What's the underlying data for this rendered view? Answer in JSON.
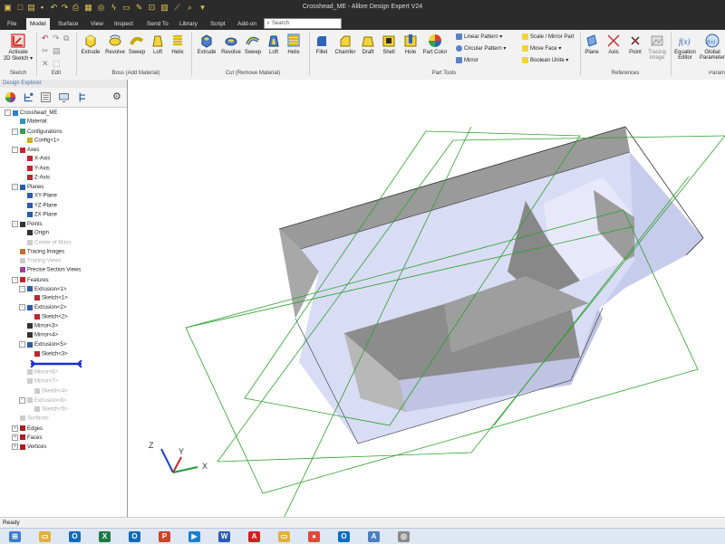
{
  "window": {
    "title": "Crosshead_ME - Alibre Design Expert V24"
  },
  "quick_access": [
    "new-icon",
    "open-icon",
    "save-icon",
    "undo-icon",
    "redo-icon",
    "print-icon",
    "dropdown-icon"
  ],
  "tabs": [
    {
      "label": "File",
      "active": false
    },
    {
      "label": "Model",
      "active": true
    },
    {
      "label": "Surface",
      "active": false
    },
    {
      "label": "View",
      "active": false
    },
    {
      "label": "Inspect",
      "active": false
    },
    {
      "label": "Send To",
      "active": false
    },
    {
      "label": "Library",
      "active": false
    },
    {
      "label": "Script",
      "active": false
    },
    {
      "label": "Add-on",
      "active": false
    }
  ],
  "search": {
    "placeholder": "Search"
  },
  "ribbon": {
    "sketch": {
      "activate_label": "Activate",
      "activate_sub": "2D Sketch ▾",
      "group": "Sketch"
    },
    "edit": {
      "group": "Edit"
    },
    "boss": {
      "group": "Boss (Add Material)",
      "buttons": [
        "Extrude",
        "Revolve",
        "Sweep",
        "Loft",
        "Helix"
      ]
    },
    "cut": {
      "group": "Cut (Remove Material)",
      "buttons": [
        "Extrude",
        "Revolve",
        "Sweep",
        "Loft",
        "Helix"
      ]
    },
    "part_tools": {
      "group": "Part Tools",
      "buttons": [
        "Fillet",
        "Chamfer",
        "Draft",
        "Shell",
        "Hole",
        "Part Color"
      ],
      "small": [
        "Linear Pattern ▾",
        "Circular Pattern ▾",
        "Mirror",
        "Scale / Mirror Part",
        "Move Face ▾",
        "Boolean Unite ▾"
      ]
    },
    "references": {
      "group": "References",
      "buttons": [
        "Plane",
        "Axis",
        "Point",
        "Tracing Image"
      ]
    },
    "params": {
      "buttons": [
        "Equation Editor",
        "Global Parameters"
      ],
      "group": "Param"
    }
  },
  "explorer": {
    "title": "Design Explorer",
    "tree": [
      {
        "label": "Crosshead_ME",
        "indent": 0,
        "exp": "-",
        "icon": "part-icon",
        "dim": false
      },
      {
        "label": "Material:",
        "indent": 1,
        "exp": "",
        "icon": "material-icon",
        "dim": false
      },
      {
        "label": "Configurations",
        "indent": 1,
        "exp": "-",
        "icon": "config-icon",
        "dim": false
      },
      {
        "label": "Config<1>",
        "indent": 2,
        "exp": "",
        "icon": "config-item-icon",
        "dim": false
      },
      {
        "label": "Axes",
        "indent": 1,
        "exp": "-",
        "icon": "axes-icon",
        "dim": false
      },
      {
        "label": "X-Axis",
        "indent": 2,
        "exp": "",
        "icon": "axis-icon",
        "dim": false
      },
      {
        "label": "Y-Axis",
        "indent": 2,
        "exp": "",
        "icon": "axis-icon",
        "dim": false
      },
      {
        "label": "Z-Axis",
        "indent": 2,
        "exp": "",
        "icon": "axis-icon",
        "dim": false
      },
      {
        "label": "Planes",
        "indent": 1,
        "exp": "-",
        "icon": "planes-icon",
        "dim": false
      },
      {
        "label": "XY-Plane",
        "indent": 2,
        "exp": "",
        "icon": "plane-icon",
        "dim": false
      },
      {
        "label": "YZ-Plane",
        "indent": 2,
        "exp": "",
        "icon": "plane-icon",
        "dim": false
      },
      {
        "label": "ZX-Plane",
        "indent": 2,
        "exp": "",
        "icon": "plane-icon",
        "dim": false
      },
      {
        "label": "Points",
        "indent": 1,
        "exp": "-",
        "icon": "points-icon",
        "dim": false
      },
      {
        "label": "Origin",
        "indent": 2,
        "exp": "",
        "icon": "point-icon",
        "dim": false
      },
      {
        "label": "Center of Mass",
        "indent": 2,
        "exp": "",
        "icon": "point-icon",
        "dim": true
      },
      {
        "label": "Tracing Images",
        "indent": 1,
        "exp": "",
        "icon": "image-icon",
        "dim": false
      },
      {
        "label": "Tracing Views",
        "indent": 1,
        "exp": "",
        "icon": "image-icon",
        "dim": true
      },
      {
        "label": "Precise Section Views",
        "indent": 1,
        "exp": "",
        "icon": "section-icon",
        "dim": false
      },
      {
        "label": "Features",
        "indent": 1,
        "exp": "-",
        "icon": "features-icon",
        "dim": false
      },
      {
        "label": "Extrusion<1>",
        "indent": 2,
        "exp": "-",
        "icon": "extrude-icon",
        "dim": false
      },
      {
        "label": "Sketch<1>",
        "indent": 3,
        "exp": "",
        "icon": "sketch-icon",
        "dim": false
      },
      {
        "label": "Extrusion<2>",
        "indent": 2,
        "exp": "-",
        "icon": "extrude-icon",
        "dim": false
      },
      {
        "label": "Sketch<2>",
        "indent": 3,
        "exp": "",
        "icon": "sketch-icon",
        "dim": false
      },
      {
        "label": "Mirror<3>",
        "indent": 2,
        "exp": "",
        "icon": "mirror-icon",
        "dim": false
      },
      {
        "label": "Mirror<4>",
        "indent": 2,
        "exp": "",
        "icon": "mirror-icon",
        "dim": false
      },
      {
        "label": "Extrusion<5>",
        "indent": 2,
        "exp": "-",
        "icon": "extrude-icon",
        "dim": false
      },
      {
        "label": "Sketch<3>",
        "indent": 3,
        "exp": "",
        "icon": "sketch-icon",
        "dim": false
      },
      {
        "label": "",
        "indent": 1,
        "exp": "",
        "icon": "rollback-bar",
        "dim": false
      },
      {
        "label": "Mirror<6>",
        "indent": 2,
        "exp": "",
        "icon": "mirror-icon",
        "dim": true
      },
      {
        "label": "Mirror<7>",
        "indent": 2,
        "exp": "",
        "icon": "mirror-icon",
        "dim": true
      },
      {
        "label": "Sketch<4>",
        "indent": 3,
        "exp": "",
        "icon": "sketch-icon",
        "dim": true
      },
      {
        "label": "Extrusion<8>",
        "indent": 2,
        "exp": "-",
        "icon": "extrude-icon",
        "dim": true
      },
      {
        "label": "Sketch<5>",
        "indent": 3,
        "exp": "",
        "icon": "sketch-icon",
        "dim": true
      },
      {
        "label": "Surfaces",
        "indent": 1,
        "exp": "",
        "icon": "surfaces-icon",
        "dim": true
      },
      {
        "label": "Edges",
        "indent": 1,
        "exp": "+",
        "icon": "edges-icon",
        "dim": false
      },
      {
        "label": "Faces",
        "indent": 1,
        "exp": "+",
        "icon": "faces-icon",
        "dim": false
      },
      {
        "label": "Vertices",
        "indent": 1,
        "exp": "+",
        "icon": "vertices-icon",
        "dim": false
      }
    ]
  },
  "viewport": {
    "triad": {
      "x": "X",
      "y": "Y",
      "z": "Z"
    }
  },
  "status": {
    "text": "Ready"
  },
  "taskbar": [
    {
      "name": "start-button",
      "color": "#3a7bd5",
      "glyph": "⊞"
    },
    {
      "name": "explorer-app",
      "color": "#e0b040",
      "glyph": "▭"
    },
    {
      "name": "outlook-app",
      "color": "#0f6cbd",
      "glyph": "O"
    },
    {
      "name": "excel-app",
      "color": "#1d7a45",
      "glyph": "X"
    },
    {
      "name": "outlook2-app",
      "color": "#0f6cbd",
      "glyph": "O"
    },
    {
      "name": "powerpoint-app",
      "color": "#c8442a",
      "glyph": "P"
    },
    {
      "name": "media-app",
      "color": "#1a7fd0",
      "glyph": "▶"
    },
    {
      "name": "word-app",
      "color": "#2b5cb0",
      "glyph": "W"
    },
    {
      "name": "acrobat-app",
      "color": "#d02020",
      "glyph": "A"
    },
    {
      "name": "explorer2-app",
      "color": "#e0b040",
      "glyph": "▭"
    },
    {
      "name": "chrome-app",
      "color": "#de4a3a",
      "glyph": "●"
    },
    {
      "name": "outlook3-app",
      "color": "#0f6cbd",
      "glyph": "O"
    },
    {
      "name": "alibre-app",
      "color": "#4a7fc0",
      "glyph": "A"
    },
    {
      "name": "other-app",
      "color": "#8a8a8a",
      "glyph": "◎"
    }
  ]
}
